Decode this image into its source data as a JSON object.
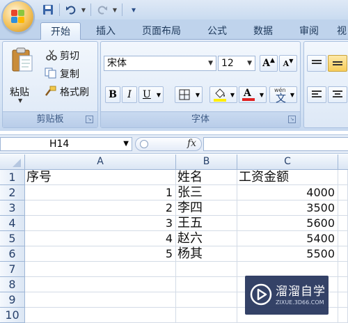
{
  "quick_access": {
    "dropdown_glyph": "▾"
  },
  "tabs": [
    "开始",
    "插入",
    "页面布局",
    "公式",
    "数据",
    "审阅",
    "视"
  ],
  "clipboard": {
    "paste": "粘贴",
    "cut": "剪切",
    "copy": "复制",
    "format_painter": "格式刷",
    "group_label": "剪贴板"
  },
  "font": {
    "name": "宋体",
    "size": "12",
    "bold": "B",
    "italic": "I",
    "underline": "U",
    "font_color_glyph": "A",
    "grow": "A",
    "shrink": "A",
    "phonetic_small": "wén",
    "phonetic": "文",
    "group_label": "字体"
  },
  "formula_bar": {
    "name_box": "H14",
    "fx": "fx"
  },
  "sheet": {
    "columns": [
      "A",
      "B",
      "C"
    ],
    "rows": [
      {
        "num": "1",
        "a": "序号",
        "b": "姓名",
        "c": "工资金额"
      },
      {
        "num": "2",
        "a": "1",
        "b": "张三",
        "c": "4000"
      },
      {
        "num": "3",
        "a": "2",
        "b": "李四",
        "c": "3500"
      },
      {
        "num": "4",
        "a": "3",
        "b": "王五",
        "c": "5600"
      },
      {
        "num": "5",
        "a": "4",
        "b": "赵六",
        "c": "5400"
      },
      {
        "num": "6",
        "a": "5",
        "b": "杨其",
        "c": "5500"
      },
      {
        "num": "7",
        "a": "",
        "b": "",
        "c": ""
      },
      {
        "num": "8",
        "a": "",
        "b": "",
        "c": ""
      },
      {
        "num": "9",
        "a": "",
        "b": "",
        "c": ""
      },
      {
        "num": "10",
        "a": "",
        "b": "",
        "c": ""
      }
    ]
  },
  "watermark": {
    "title": "溜溜自学",
    "url": "ZIXUE.3D66.COM"
  },
  "colors": {
    "accent": "#1e395b",
    "font_color_bar": "#e02020",
    "fill_color_bar": "#ffee00",
    "header_blue": "#dbe6f4"
  }
}
